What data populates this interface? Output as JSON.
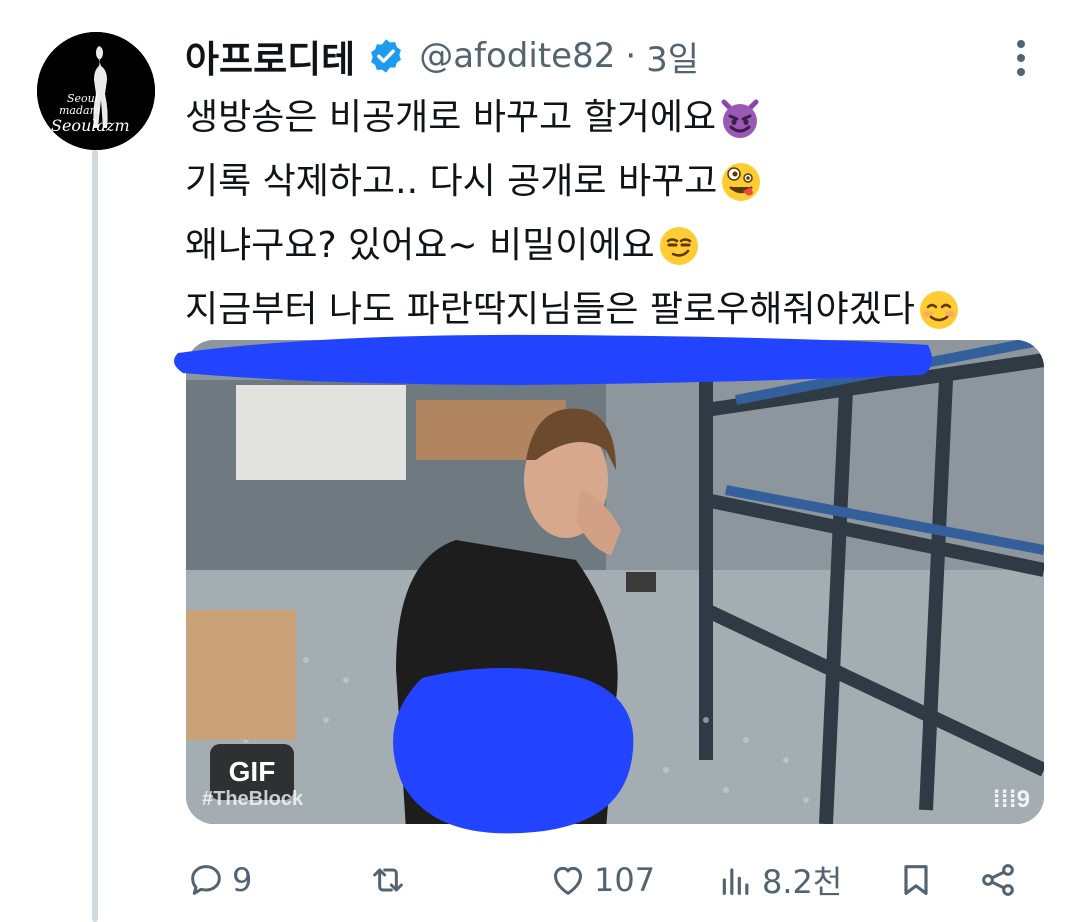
{
  "tweet": {
    "author": {
      "display_name": "아프로디테",
      "handle": "@afodite82",
      "time": "3일",
      "avatar_text": [
        "Seoul",
        "madam",
        "Seoulazm"
      ],
      "verified_color": "#1d9bf0"
    },
    "text_lines": [
      {
        "text": "생방송은 비공개로 바꾸고 할거에요",
        "emoji": "smiling-imp-emoji"
      },
      {
        "text": "기록 삭제하고.. 다시 공개로 바꾸고",
        "emoji": "zany-face-emoji"
      },
      {
        "text": "왜냐구요? 있어요~ 비밀이에요",
        "emoji": "smirking-face-emoji"
      },
      {
        "text": "지금부터 나도 파란딱지님들은 팔로우해줘야겠다",
        "emoji": "smiling-face-emoji"
      }
    ],
    "media": {
      "badge": "GIF",
      "hashtag_overlay": "#TheBlock",
      "network_logo": "⁞⁞⁞9"
    },
    "actions": {
      "replies": "9",
      "retweets": "",
      "likes": "107",
      "views": "8.2천"
    },
    "redaction_color": "#2244ff"
  }
}
